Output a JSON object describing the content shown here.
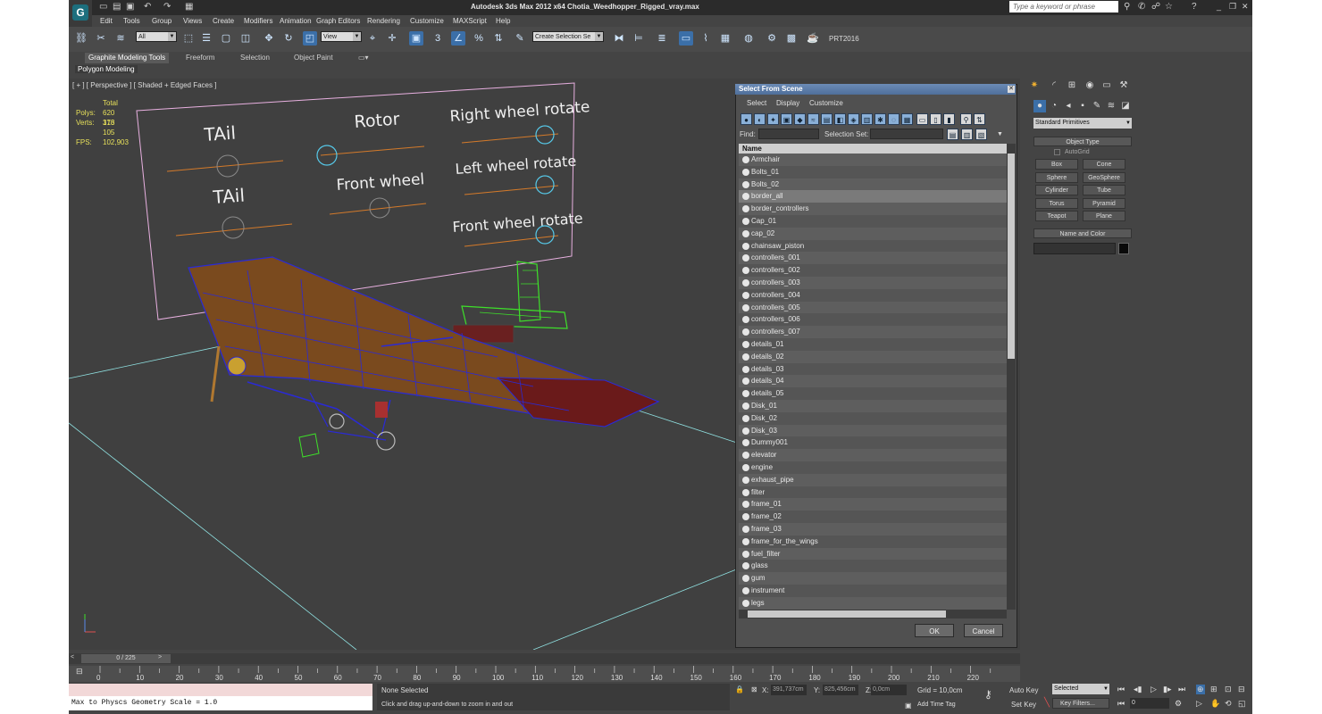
{
  "app": {
    "title": "Autodesk 3ds Max  2012 x64    Chotia_Weedhopper_Rigged_vray.max",
    "logo_letter": "G",
    "search_placeholder": "Type a keyword or phrase",
    "window_controls": [
      "_",
      "❐",
      "✕"
    ]
  },
  "menu": [
    "Edit",
    "Tools",
    "Group",
    "Views",
    "Create",
    "Modifiers",
    "Animation",
    "Graph Editors",
    "Rendering",
    "Customize",
    "MAXScript",
    "Help"
  ],
  "toolbar": {
    "filter_value": "All",
    "refcoord_value": "View",
    "selection_set_value": "Create Selection Se",
    "prt_label": "PRT2016"
  },
  "ribbon": {
    "tabs": [
      "Graphite Modeling Tools",
      "Freeform",
      "Selection",
      "Object Paint"
    ],
    "active_tab": "Graphite Modeling Tools",
    "subpanel": "Polygon Modeling"
  },
  "viewport": {
    "label": "[ + ] [ Perspective ] [ Shaded + Edged Faces ]",
    "stats": {
      "total_label": "Total",
      "polys_label": "Polys:",
      "polys_value": "620 173",
      "verts_label": "Verts:",
      "verts_value": "316 105",
      "fps_label": "FPS:",
      "fps_value": "102,903"
    },
    "controller_labels": [
      "TAil",
      "Rotor",
      "Right wheel rotate",
      "TAil",
      "Front wheel",
      "Left wheel rotate",
      "Front wheel rotate"
    ]
  },
  "dialog": {
    "title": "Select From Scene",
    "close": "✕",
    "menu": [
      "Select",
      "Display",
      "Customize"
    ],
    "find_label": "Find:",
    "selection_set_label": "Selection Set:",
    "column_header": "Name",
    "items": [
      "Armchair",
      "Bolts_01",
      "Bolts_02",
      "border_all",
      "border_controllers",
      "Cap_01",
      "cap_02",
      "chainsaw_piston",
      "controllers_001",
      "controllers_002",
      "controllers_003",
      "controllers_004",
      "controllers_005",
      "controllers_006",
      "controllers_007",
      "details_01",
      "details_02",
      "details_03",
      "details_04",
      "details_05",
      "Disk_01",
      "Disk_02",
      "Disk_03",
      "Dummy001",
      "elevator",
      "engine",
      "exhaust_pipe",
      "filter",
      "frame_01",
      "frame_02",
      "frame_03",
      "frame_for_the_wings",
      "fuel_filter",
      "glass",
      "gum",
      "instrument",
      "legs"
    ],
    "selected_item": "border_all",
    "ok": "OK",
    "cancel": "Cancel"
  },
  "command_panel": {
    "category": "Standard Primitives",
    "object_type_title": "Object Type",
    "autogrid_label": "AutoGrid",
    "primitives": [
      "Box",
      "Cone",
      "Sphere",
      "GeoSphere",
      "Cylinder",
      "Tube",
      "Torus",
      "Pyramid",
      "Teapot",
      "Plane"
    ],
    "name_color_title": "Name and Color"
  },
  "timeline": {
    "position_label": "0 / 225",
    "ticks": [
      "0",
      "10",
      "20",
      "30",
      "40",
      "50",
      "60",
      "70",
      "80",
      "90",
      "100",
      "110",
      "120",
      "130",
      "140",
      "150",
      "160",
      "170",
      "180",
      "190",
      "200",
      "210",
      "220"
    ]
  },
  "status": {
    "script_output": "Max to Physcs Geometry Scale = 1.0",
    "selection": "None Selected",
    "prompt": "Click and drag up-and-down to zoom in and out",
    "x_label": "X:",
    "x_value": "391,737cm",
    "y_label": "Y:",
    "y_value": "825,456cm",
    "z_label": "Z:",
    "z_value": "0,0cm",
    "grid": "Grid = 10,0cm",
    "add_time_tag": "Add Time Tag",
    "auto_key_label": "Auto Key",
    "auto_key_value": "Selected",
    "set_key_label": "Set Key",
    "key_filters": "Key Filters...",
    "frame_value": "0"
  },
  "colors": {
    "wing_fill": "#7a4a1e",
    "wire_blue": "#2a2ad6",
    "tail_green": "#3ee02a",
    "board_outline": "#e8b0e0",
    "slider_orange": "#d47a2a",
    "knob_cyan": "#56c8e8"
  }
}
